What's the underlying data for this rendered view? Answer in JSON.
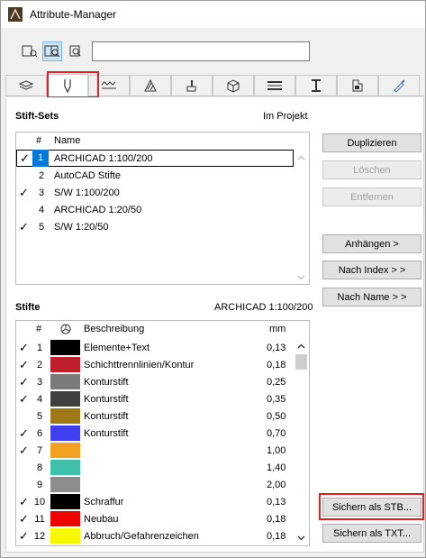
{
  "window": {
    "title": "Attribute-Manager"
  },
  "search": {
    "value": ""
  },
  "tabs": [
    {
      "icon": "layers-icon"
    },
    {
      "icon": "pen-icon"
    },
    {
      "icon": "line-type-icon"
    },
    {
      "icon": "fill-icon"
    },
    {
      "icon": "surface-brush-icon"
    },
    {
      "icon": "building-material-icon"
    },
    {
      "icon": "composite-icon"
    },
    {
      "icon": "profile-icon"
    },
    {
      "icon": "zone-icon"
    },
    {
      "icon": "paint-icon"
    }
  ],
  "pen_sets": {
    "label": "Stift-Sets",
    "scope": "Im Projekt",
    "col_num": "#",
    "col_name": "Name",
    "rows": [
      {
        "checked": true,
        "num": "1",
        "name": "ARCHICAD 1:100/200",
        "selected": true
      },
      {
        "checked": false,
        "num": "2",
        "name": "AutoCAD Stifte",
        "selected": false
      },
      {
        "checked": true,
        "num": "3",
        "name": "S/W 1:100/200",
        "selected": false
      },
      {
        "checked": false,
        "num": "4",
        "name": "ARCHICAD 1:20/50",
        "selected": false
      },
      {
        "checked": true,
        "num": "5",
        "name": "S/W 1:20/50",
        "selected": false
      }
    ]
  },
  "pens": {
    "label": "Stifte",
    "set_name": "ARCHICAD 1:100/200",
    "col_num": "#",
    "col_desc": "Beschreibung",
    "col_mm": "mm",
    "rows": [
      {
        "checked": true,
        "num": "1",
        "color": "#000000",
        "desc": "Elemente+Text",
        "mm": "0,13"
      },
      {
        "checked": true,
        "num": "2",
        "color": "#c0202e",
        "desc": "Schichttrennlinien/Kontur",
        "mm": "0,18"
      },
      {
        "checked": true,
        "num": "3",
        "color": "#7a7a7a",
        "desc": "Konturstift",
        "mm": "0,25"
      },
      {
        "checked": true,
        "num": "4",
        "color": "#404040",
        "desc": "Konturstift",
        "mm": "0,35"
      },
      {
        "checked": false,
        "num": "5",
        "color": "#a07818",
        "desc": "Konturstift",
        "mm": "0,50"
      },
      {
        "checked": true,
        "num": "6",
        "color": "#4040f0",
        "desc": "Konturstift",
        "mm": "0,70"
      },
      {
        "checked": true,
        "num": "7",
        "color": "#f4a020",
        "desc": "",
        "mm": "1,00"
      },
      {
        "checked": false,
        "num": "8",
        "color": "#40c0a8",
        "desc": "",
        "mm": "1,40"
      },
      {
        "checked": false,
        "num": "9",
        "color": "#8c8c8c",
        "desc": "",
        "mm": "2,00"
      },
      {
        "checked": true,
        "num": "10",
        "color": "#000000",
        "desc": "Schraffur",
        "mm": "0,13"
      },
      {
        "checked": true,
        "num": "11",
        "color": "#f00000",
        "desc": "Neubau",
        "mm": "0,18"
      },
      {
        "checked": true,
        "num": "12",
        "color": "#f8f800",
        "desc": "Abbruch/Gefahrenzeichen",
        "mm": "0,18"
      }
    ]
  },
  "buttons": {
    "duplicate": "Duplizieren",
    "delete": "Löschen",
    "remove": "Entfernen",
    "append": "Anhängen >",
    "by_index": "Nach Index > >",
    "by_name": "Nach Name > >",
    "save_stb": "Sichern als STB...",
    "save_txt": "Sichern als TXT..."
  }
}
